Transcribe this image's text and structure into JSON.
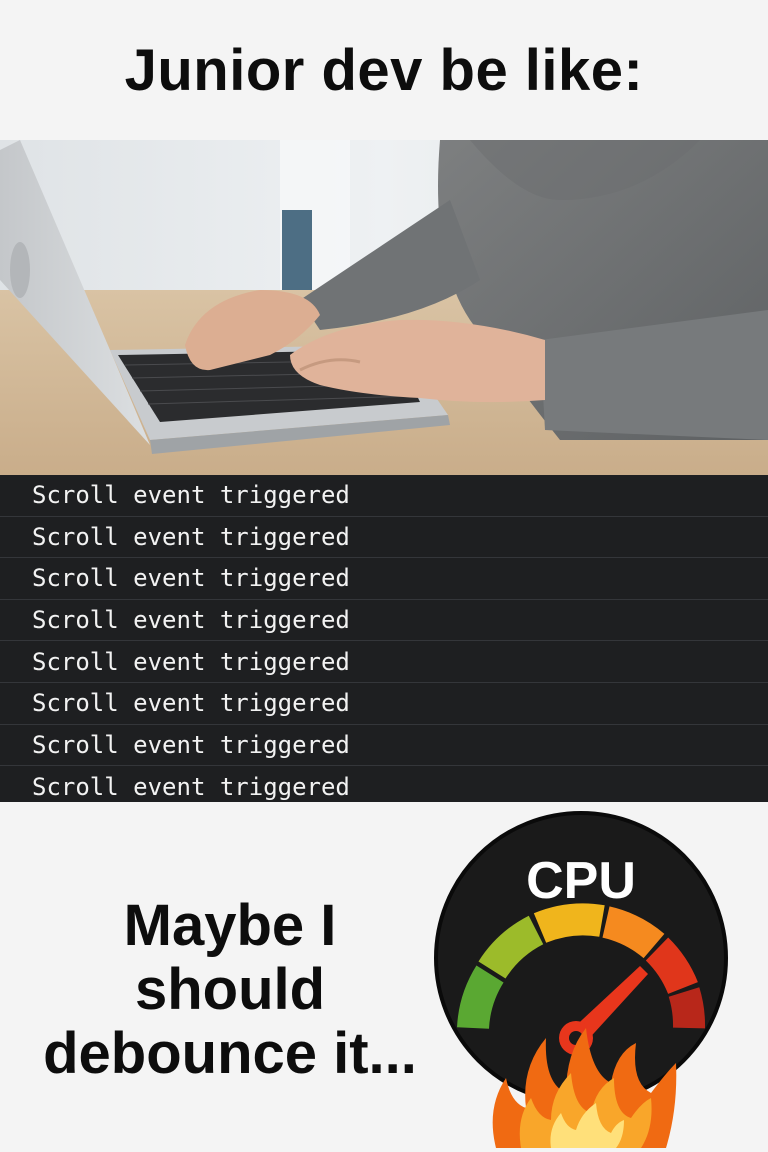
{
  "meme": {
    "top_caption": "Junior dev be like:",
    "bottom_caption_lines": [
      "Maybe I",
      "should",
      "debounce it..."
    ]
  },
  "console": {
    "log_lines": [
      "Scroll event triggered",
      "Scroll event triggered",
      "Scroll event triggered",
      "Scroll event triggered",
      "Scroll event triggered",
      "Scroll event triggered",
      "Scroll event triggered",
      "Scroll event triggered"
    ]
  },
  "cpu_gauge": {
    "label": "CPU",
    "needle_level": "high",
    "colors": {
      "green": "#5aa832",
      "yellow": "#f0b51c",
      "orange": "#f58a1f",
      "red": "#e0361b",
      "dial": "#1a1a1a"
    }
  },
  "icons": [
    "laptop-photo",
    "cpu-gauge-icon",
    "fire-icon"
  ]
}
